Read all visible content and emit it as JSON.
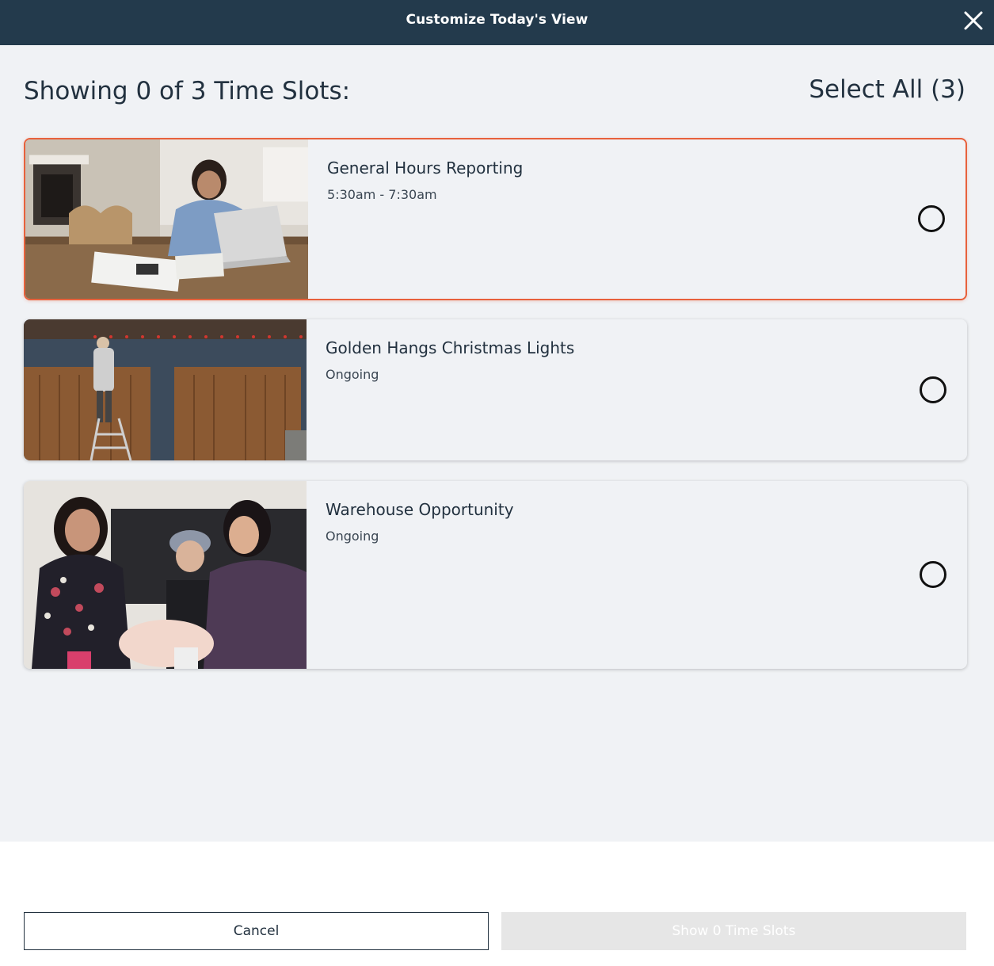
{
  "header": {
    "title": "Customize Today's View",
    "close_icon": "close-icon"
  },
  "main": {
    "heading": "Showing 0 of 3 Time Slots:",
    "select_all_label": "Select All (3)",
    "slots": [
      {
        "title": "General Hours Reporting",
        "subtitle": "5:30am - 7:30am",
        "image": "woman working on laptop at kitchen table",
        "selected_outline": true,
        "checked": false
      },
      {
        "title": "Golden Hangs Christmas Lights",
        "subtitle": "Ongoing",
        "image": "person on ladder hanging christmas lights above garage",
        "selected_outline": false,
        "checked": false
      },
      {
        "title": "Warehouse Opportunity",
        "subtitle": "Ongoing",
        "image": "three people folding blankets at a table",
        "selected_outline": false,
        "checked": false
      }
    ]
  },
  "footer": {
    "cancel_label": "Cancel",
    "show_label": "Show 0 Time Slots"
  },
  "colors": {
    "header_bg": "#233a4c",
    "content_bg": "#f0f2f5",
    "accent_outline": "#e8613c",
    "disabled_button": "#e6e6e6"
  }
}
